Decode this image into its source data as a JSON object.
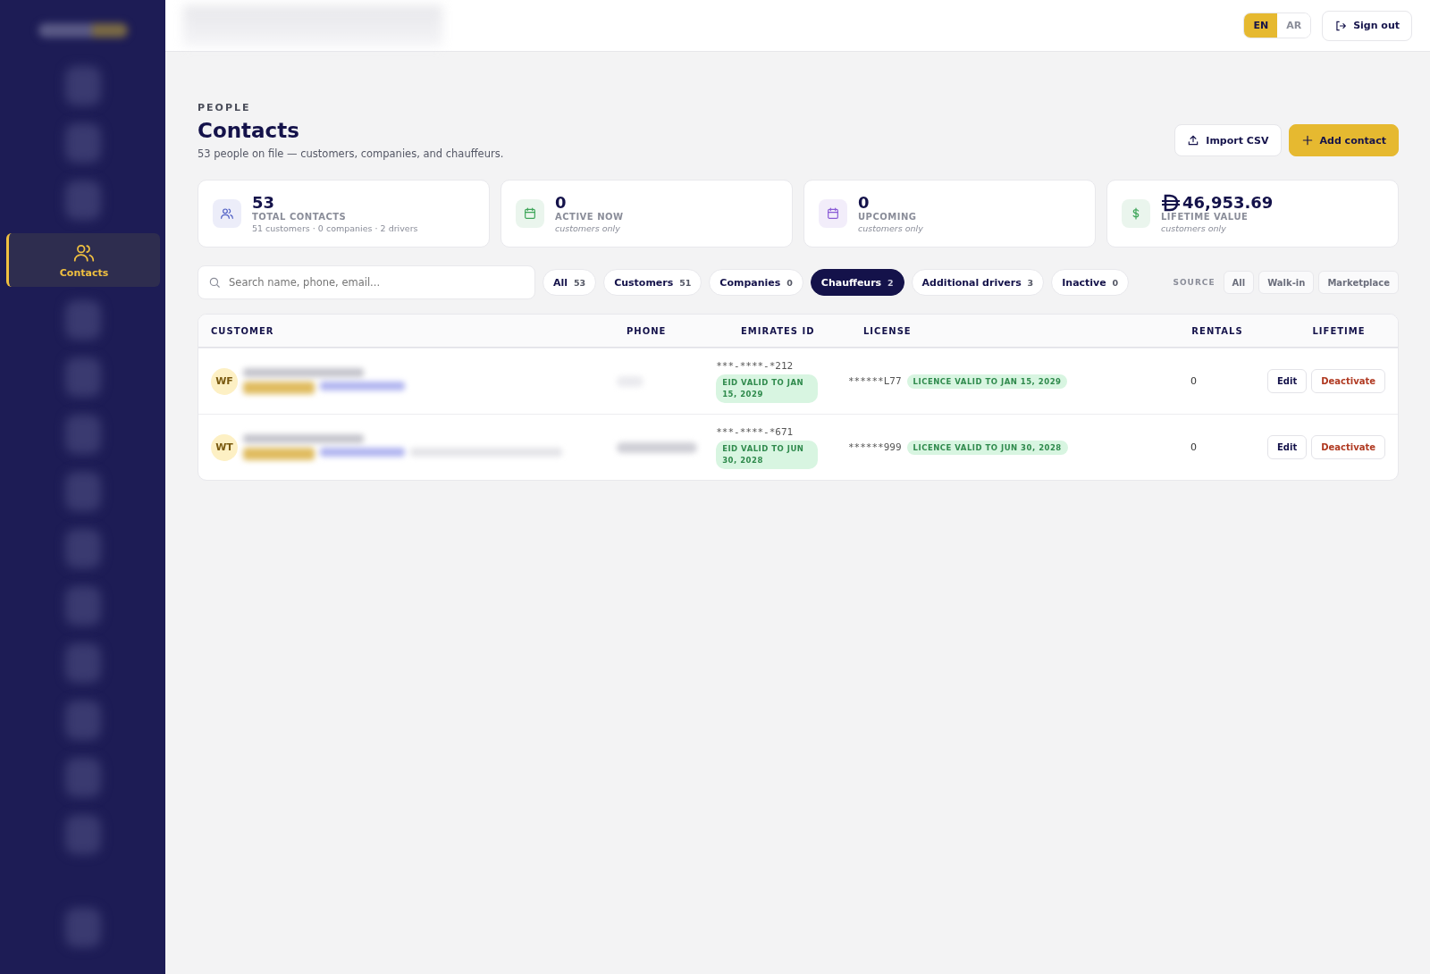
{
  "language_toggle": [
    {
      "label": "EN",
      "selected": true
    },
    {
      "label": "AR",
      "selected": false
    }
  ],
  "sign_out": "Sign out",
  "sidebar": {
    "items": [
      {
        "label": "Contacts",
        "selected": true
      }
    ]
  },
  "page": {
    "eyebrow": "PEOPLE",
    "title": "Contacts",
    "subtitle": "53 people on file — customers, companies, and chauffeurs."
  },
  "actions": [
    {
      "label": "Import CSV",
      "kind": "upload"
    },
    {
      "label": "Add contact",
      "kind": "add"
    }
  ],
  "stats": [
    {
      "kind": "total",
      "color": "#4f5fc4",
      "value": "53",
      "label": "TOTAL CONTACTS",
      "note": "51 customers · 0 companies · 2 drivers"
    },
    {
      "kind": "active",
      "color": "#3fa65a",
      "value": "0",
      "label": "ACTIVE NOW",
      "note": "customers only"
    },
    {
      "kind": "upcoming",
      "color": "#8a5cd6",
      "value": "0",
      "label": "UPCOMING",
      "note": "customers only"
    },
    {
      "kind": "lifetime",
      "color": "#3fa65a",
      "value": "46,953.69",
      "label": "LIFETIME VALUE",
      "note": "customers only"
    }
  ],
  "search": {
    "placeholder": "Search name, phone, email..."
  },
  "tabs": [
    {
      "label": "All",
      "count": "53",
      "selected": false
    },
    {
      "label": "Customers",
      "count": "51",
      "selected": false
    },
    {
      "label": "Companies",
      "count": "0",
      "selected": false
    },
    {
      "label": "Chauffeurs",
      "count": "2",
      "selected": true
    },
    {
      "label": "Additional drivers",
      "count": "3",
      "selected": false
    },
    {
      "label": "Inactive",
      "count": "0",
      "selected": false
    }
  ],
  "source": {
    "label": "SOURCE",
    "options": [
      "All",
      "Walk-in",
      "Marketplace"
    ]
  },
  "table": {
    "columns": [
      "CUSTOMER",
      "PHONE",
      "EMIRATES ID",
      "LICENSE",
      "RENTALS",
      "LIFETIME"
    ],
    "rows": [
      {
        "initials": "WF",
        "emirates_id": "***-****-*212",
        "eid_badge": "EID VALID TO JAN 15, 2029",
        "license": "******L77",
        "license_badge": "LICENCE VALID TO JAN 15, 2029",
        "rentals": "0",
        "actions": [
          "Edit",
          "Deactivate"
        ]
      },
      {
        "initials": "WT",
        "emirates_id": "***-****-*671",
        "eid_badge": "EID VALID TO JUN 30, 2028",
        "license": "******999",
        "license_badge": "LICENCE VALID TO JUN 30, 2028",
        "rentals": "0",
        "actions": [
          "Edit",
          "Deactivate"
        ]
      }
    ]
  }
}
